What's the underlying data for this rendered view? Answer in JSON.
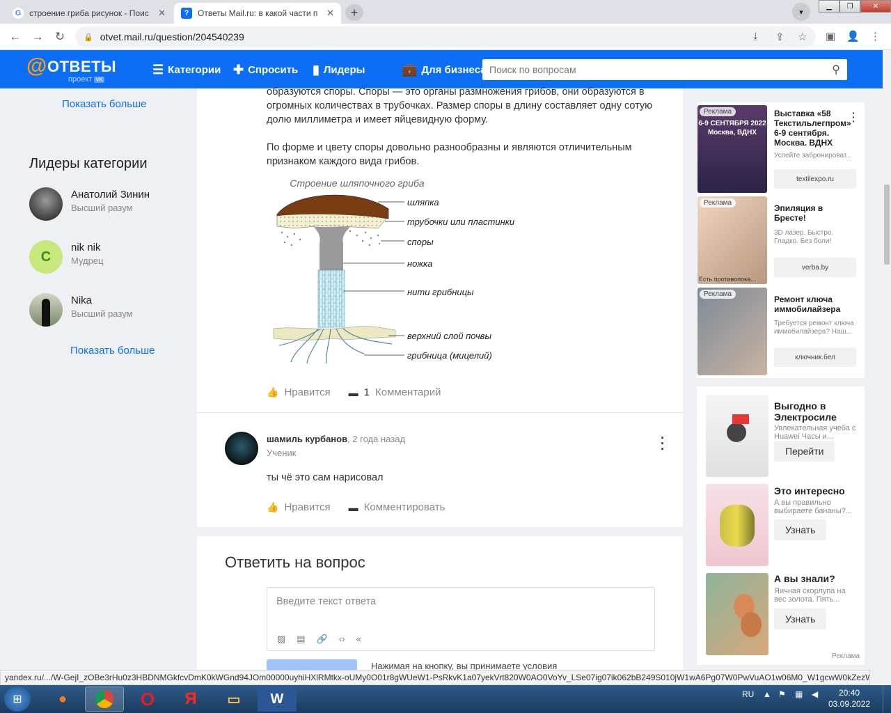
{
  "browser": {
    "tabs": [
      {
        "title": "строение гриба рисунок - Поис",
        "icon": "google-icon"
      },
      {
        "title": "Ответы Mail.ru: в какой части п",
        "icon": "mail-answers-icon"
      }
    ],
    "url": "otvet.mail.ru/question/204540239",
    "status_url": "yandex.ru/.../W-GejI_zOBe3rHu0z3HBDNMGkfcvDmK0kWGnd94JOm00000uyhiHXlRMtkx-oUMy0O01r8gWUeW1-PsRkvK1a07yekVrt820W0AO0VoYv_LSe07ig07ik062bB249S010jW1wA6Pg07W0PwVuAO1w06M0_W1gcwW0kZezW6v0..."
  },
  "header": {
    "logo_word": "ОТВЕТЫ",
    "logo_sub": "проект",
    "nav": [
      "Категории",
      "Спросить",
      "Лидеры",
      "Для бизнеса"
    ],
    "search_placeholder": "Поиск по вопросам"
  },
  "left": {
    "show_more_top": "Показать больше",
    "leaders_title": "Лидеры категории",
    "leaders": [
      {
        "name": "Анатолий Зинин",
        "rank": "Высший разум"
      },
      {
        "name": "nik nik",
        "rank": "Мудрец",
        "initial": "C"
      },
      {
        "name": "Nika",
        "rank": "Высший разум"
      }
    ],
    "show_more_bottom": "Показать больше"
  },
  "answer": {
    "para1": "образуются споры. Споры — это органы размножения грибов, они образуются в огромных количествах в трубочках. Размер споры в длину составляет одну сотую долю миллиметра и имеет яйцевидную форму.",
    "para2": "По форме и цвету споры довольно разнообразны и являются отличительным признаком каждого вида грибов.",
    "diagram": {
      "title": "Строение шляпочного гриба",
      "labels": [
        "шляпка",
        "трубочки или пластинки",
        "споры",
        "ножка",
        "нити грибницы",
        "верхний слой почвы",
        "грибница (мицелий)"
      ]
    },
    "like_label": "Нравится",
    "comment_count": "1",
    "comment_label": "Комментарий"
  },
  "comment": {
    "author": "шамиль курбанов",
    "time": ", 2 года назад",
    "rank": "Ученик",
    "text": "ты чё это сам нарисовал",
    "like_label": "Нравится",
    "comment_label": "Комментировать"
  },
  "reply": {
    "title": "Ответить на вопрос",
    "placeholder": "Введите текст ответа",
    "note": "Нажимая на кнопку, вы принимаете условия"
  },
  "ads_top": [
    {
      "badge": "Реклама",
      "title": "Выставка «58 Текстильлегпром» 6-9 сентября. Москва. ВДНХ",
      "desc": "Успейте забронироват...",
      "domain": "textilexpo.ru",
      "img_text": "6-9 СЕНТЯБРЯ 2022 Москва, ВДНХ"
    },
    {
      "badge": "Реклама",
      "title": "Эпиляция в Бресте!",
      "desc": "3D лазер. Быстро. Гладко. Без боли!",
      "domain": "verba.by",
      "img_caption": "Есть противопока..."
    },
    {
      "badge": "Реклама",
      "title": "Ремонт ключа иммобилайзера",
      "desc": "Требуется ремонт ключа иммобилайзера? Наш...",
      "domain": "ключник.бел"
    }
  ],
  "ads_bottom": [
    {
      "title": "Выгодно в Электросиле",
      "desc": "Увлекательная учеба с Huawei Часы и...",
      "button": "Перейти"
    },
    {
      "title": "Это интересно",
      "desc": "А вы правильно выбираете бананы?...",
      "button": "Узнать"
    },
    {
      "title": "А вы знали?",
      "desc": "Яичная скорлупа на вес золота. Пять...",
      "button": "Узнать"
    }
  ],
  "ads_footer": "Реклама",
  "taskbar": {
    "lang": "RU",
    "time": "20:40",
    "date": "03.09.2022"
  }
}
